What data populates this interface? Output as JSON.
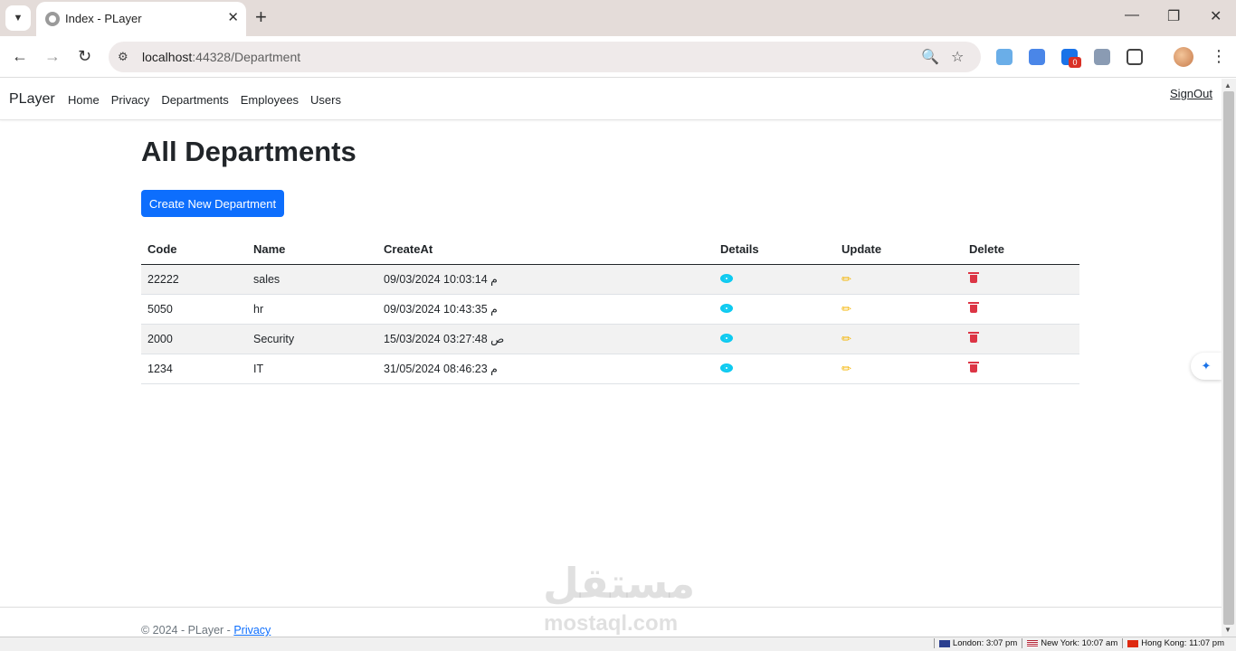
{
  "browser": {
    "tab_title": "Index - PLayer",
    "url_host": "localhost",
    "url_rest": ":44328/Department",
    "ext_badge_count": "0"
  },
  "navbar": {
    "brand": "PLayer",
    "links": [
      "Home",
      "Privacy",
      "Departments",
      "Employees",
      "Users"
    ],
    "signout": "SignOut"
  },
  "main": {
    "title": "All Departments",
    "create_button": "Create New Department",
    "table": {
      "headers": [
        "Code",
        "Name",
        "CreateAt",
        "Details",
        "Update",
        "Delete"
      ],
      "rows": [
        {
          "code": "22222",
          "name": "sales",
          "created": "09/03/2024 10:03:14 م"
        },
        {
          "code": "5050",
          "name": "hr",
          "created": "09/03/2024 10:43:35 م"
        },
        {
          "code": "2000",
          "name": "Security",
          "created": "15/03/2024 03:27:48 ص"
        },
        {
          "code": "1234",
          "name": "IT",
          "created": "31/05/2024 08:46:23 م"
        }
      ]
    }
  },
  "footer": {
    "text": "© 2024 - PLayer - ",
    "privacy_link": "Privacy"
  },
  "watermark": {
    "arabic": "مستقل",
    "latin": "mostaql.com"
  },
  "statusbar": {
    "clocks": [
      "London: 3:07 pm",
      "New York: 10:07 am",
      "Hong Kong: 11:07 pm"
    ]
  },
  "colors": {
    "primary": "#0d6efd",
    "info": "#0dcaf0",
    "warning": "#f4b400",
    "danger": "#dc3545"
  }
}
